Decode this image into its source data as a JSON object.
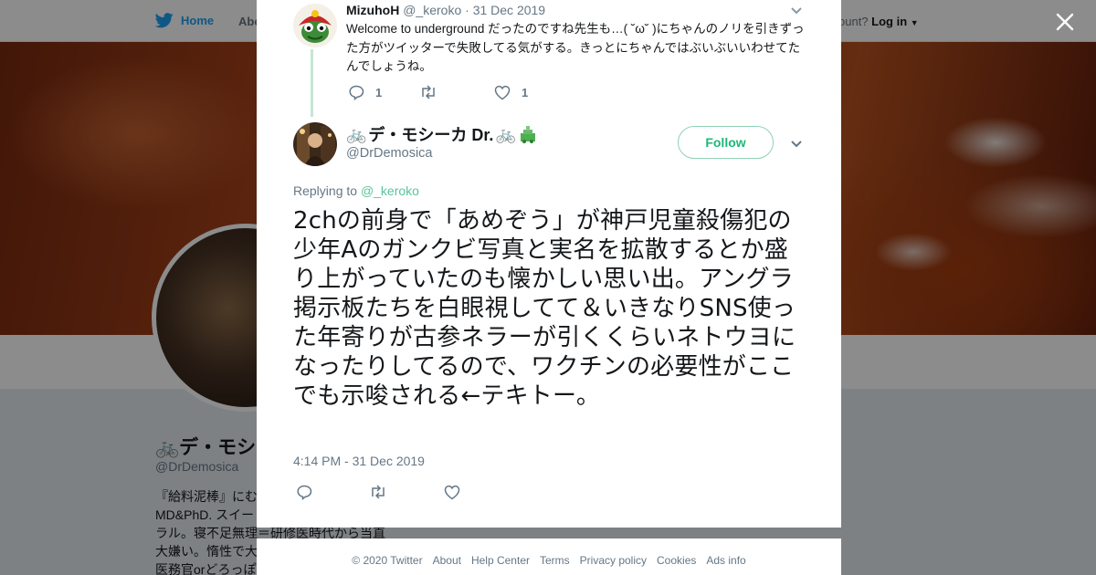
{
  "background": {
    "nav": {
      "home_label": "Home",
      "about_label": "Abo",
      "account_prompt": "ccount?",
      "login_label": "Log in"
    },
    "profile": {
      "name": "デ・モシ",
      "handle": "@DrDemosica",
      "bio_lines": [
        "『給料泥棒』にむ",
        "MD&PhD. スイー",
        "ラル。寝不足無理＝研修医時代から当直",
        "大嫌い。惰性で大",
        "医務官orどろっぽ"
      ]
    }
  },
  "modal": {
    "reply": {
      "author_name": "MizuhoH",
      "author_handle": "@_keroko",
      "separator": "·",
      "date": "31 Dec 2019",
      "text": "Welcome to underground だったのですね先生も…( ˘ω˘ )にちゃんのノリを引きずった方がツイッターで失敗してる気がする。きっとにちゃんではぶいぶいいわせてたんでしょうね。",
      "reply_count": "1",
      "like_count": "1"
    },
    "tweet": {
      "author_name": "デ・モシーカ Dr.",
      "author_handle": "@DrDemosica",
      "follow_label": "Follow",
      "replying_prefix": "Replying to",
      "replying_to": "@_keroko",
      "text": "2chの前身で「あめぞう」が神戸児童殺傷犯の少年Aのガンクビ写真と実名を拡散するとか盛り上がっていたのも懐かしい思い出。アングラ掲示板たちを白眼視してて＆いきなりSNS使った年寄りが古参ネラーが引くくらいネトウヨになったりしてるので、ワクチンの必要性がここでも示唆される←テキトー。",
      "timestamp": "4:14 PM - 31 Dec 2019"
    }
  },
  "footer": {
    "links": [
      "© 2020 Twitter",
      "About",
      "Help Center",
      "Terms",
      "Privacy policy",
      "Cookies",
      "Ads info"
    ]
  },
  "colors": {
    "twitter_blue": "#1da1f2",
    "follow_green": "#1cb87a",
    "muted_text": "#657786"
  }
}
